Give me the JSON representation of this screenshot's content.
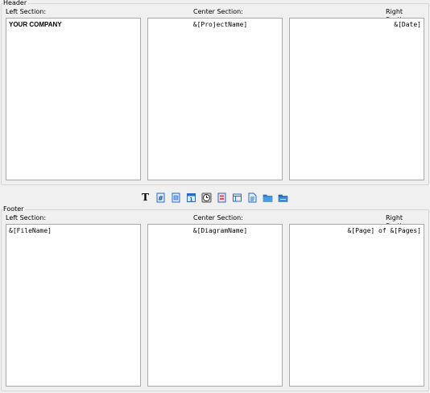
{
  "header": {
    "title": "Header",
    "left": {
      "label": "Left Section:",
      "value": "YOUR COMPANY"
    },
    "center": {
      "label": "Center Section:",
      "value": "&[ProjectName]"
    },
    "right": {
      "label": "Right Section:",
      "value": "&[Date]"
    }
  },
  "footer": {
    "title": "Footer",
    "left": {
      "label": "Left Section:",
      "value": "&[FileName]"
    },
    "center": {
      "label": "Center Section:",
      "value": "&[DiagramName]"
    },
    "right": {
      "label": "Right Section:",
      "value": "&[Page] of &[Pages]"
    }
  },
  "toolbar": {
    "text_glyph": "T",
    "icons": [
      "text-format-icon",
      "page-number-icon",
      "page-count-icon",
      "insert-date-icon",
      "insert-time-icon",
      "file-name-icon",
      "diagram-name-icon",
      "project-name-icon",
      "folder-icon",
      "folder-path-icon"
    ]
  }
}
